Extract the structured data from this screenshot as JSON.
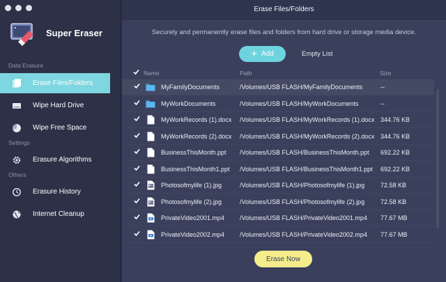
{
  "app": {
    "name": "Super Eraser",
    "window_title": "Erase Files/Folders"
  },
  "sidebar": {
    "sections": [
      {
        "label": "Data Erasure"
      },
      {
        "label": "Settings"
      },
      {
        "label": "Others"
      }
    ],
    "items": [
      {
        "label": "Erase Files/Folders",
        "icon": "files-icon",
        "active": true
      },
      {
        "label": "Wipe Hard Drive",
        "icon": "hard-drive-icon",
        "active": false
      },
      {
        "label": "Wipe Free Space",
        "icon": "pie-chart-icon",
        "active": false
      },
      {
        "label": "Erasure Algorithms",
        "icon": "gear-icon",
        "active": false
      },
      {
        "label": "Erasure History",
        "icon": "clock-icon",
        "active": false
      },
      {
        "label": "Internet Cleanup",
        "icon": "globe-icon",
        "active": false
      }
    ]
  },
  "main": {
    "subtitle": "Securely and permanently erase files and folders from hard drive or storage media device.",
    "add_label": "Add",
    "empty_label": "Empty List",
    "erase_label": "Erase Now",
    "columns": {
      "name": "Name",
      "path": "Path",
      "size": "Size"
    },
    "rows": [
      {
        "name": "MyFamilyDocuments",
        "path": "/Volumes/USB FLASH/MyFamilyDocuments",
        "size": "--",
        "type": "folder",
        "checked": true
      },
      {
        "name": "MyWorkDocuments",
        "path": "/Volumes/USB FLASH/MyWorkDocuments",
        "size": "--",
        "type": "folder",
        "checked": true
      },
      {
        "name": "MyWorkRecords (1).docx",
        "path": "/Volumes/USB FLASH/MyWorkRecords (1).docx",
        "size": "344.76 KB",
        "type": "document",
        "checked": true
      },
      {
        "name": "MyWorkRecords (2).docx",
        "path": "/Volumes/USB FLASH/MyWorkRecords (2).docx",
        "size": "344.76 KB",
        "type": "document",
        "checked": true
      },
      {
        "name": "BusinessThisMonth.ppt",
        "path": "/Volumes/USB FLASH/BusinessThisMonth.ppt",
        "size": "692.22 KB",
        "type": "document",
        "checked": true
      },
      {
        "name": "BusinessThisMonth1.ppt",
        "path": "/Volumes/USB FLASH/BusinessThisMonth1.ppt",
        "size": "692.22 KB",
        "type": "document",
        "checked": true
      },
      {
        "name": "Photosofmylife (1).jpg",
        "path": "/Volumes/USB FLASH/Photosofmylife (1).jpg",
        "size": "72.58 KB",
        "type": "image",
        "checked": true
      },
      {
        "name": "Photosofmylife (2).jpg",
        "path": "/Volumes/USB FLASH/Photosofmylife (2).jpg",
        "size": "72.58 KB",
        "type": "image",
        "checked": true
      },
      {
        "name": "PrivateVideo2001.mp4",
        "path": "/Volumes/USB FLASH/PrivateVideo2001.mp4",
        "size": "77.67 MB",
        "type": "video",
        "checked": true
      },
      {
        "name": "PrivateVideo2002.mp4",
        "path": "/Volumes/USB FLASH/PrivateVideo2002.mp4",
        "size": "77.67 MB",
        "type": "video",
        "checked": true
      }
    ]
  },
  "colors": {
    "accent": "#6ed3df",
    "active_nav": "#7ed6e0",
    "erase_button": "#f5ec8c",
    "folder": "#4aa8e8"
  }
}
